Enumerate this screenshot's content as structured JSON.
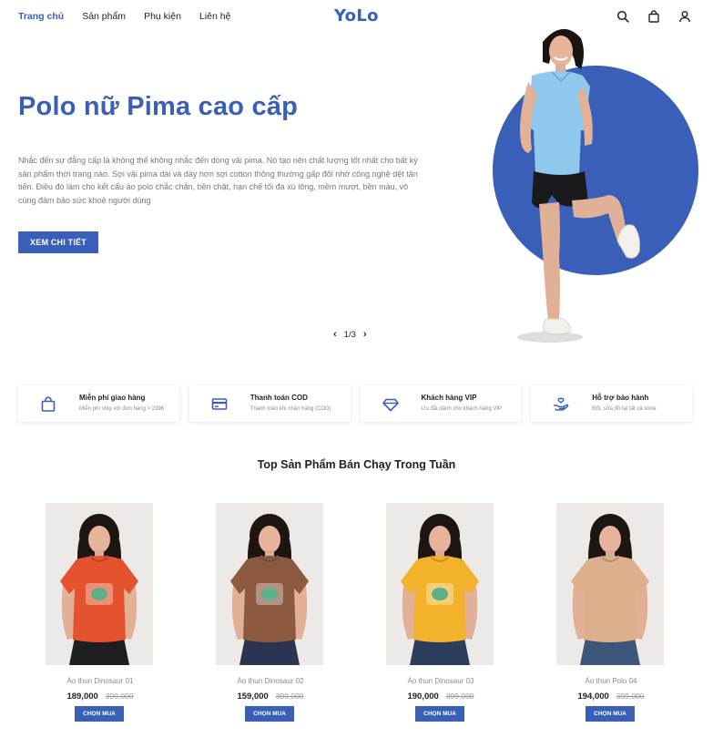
{
  "nav": {
    "items": [
      {
        "label": "Trang chủ",
        "active": true
      },
      {
        "label": "Sản phẩm",
        "active": false
      },
      {
        "label": "Phụ kiện",
        "active": false
      },
      {
        "label": "Liên hệ",
        "active": false
      }
    ],
    "logo": "YoLo",
    "icons": [
      "search-icon",
      "shopping-bag-icon",
      "user-icon"
    ]
  },
  "hero": {
    "title": "Polo nữ Pima cao cấp",
    "description": "Nhắc đến sự đẳng cấp là không thể không nhắc đến dòng vải pima. Nó tạo nên chất lượng tốt nhất cho bất kỳ sản phẩm thời trang nào. Sợi vải pima dài và dày hơn sợi cotton thông thường gấp đôi nhờ công nghệ dệt tân tiến. Điều đó làm cho kết cấu áo polo chắc chắn, bền chặt, hạn chế tối đa xù lông, mềm mượt, bền màu, vô cùng đảm bảo sức khoẻ người dùng",
    "button": "XEM CHI TIẾT",
    "slider": {
      "prev": "‹",
      "counter": "1/3",
      "next": "›"
    }
  },
  "features": [
    {
      "icon": "shopping-bag-icon",
      "title": "Miễn phí giao hàng",
      "subtitle": "Miễn phí ship với đơn hàng > 239K"
    },
    {
      "icon": "credit-card-icon",
      "title": "Thanh toán COD",
      "subtitle": "Thanh toán khi nhận hàng (COD)"
    },
    {
      "icon": "diamond-icon",
      "title": "Khách hàng VIP",
      "subtitle": "Ưu đãi dành cho khách hàng VIP"
    },
    {
      "icon": "hand-heart-icon",
      "title": "Hỗ trợ bảo hành",
      "subtitle": "Đổi, sửa đồ tại tất cả store"
    }
  ],
  "products_section": {
    "title": "Top Sản Phẩm Bán Chạy Trong Tuần",
    "items": [
      {
        "name": "Áo thun Dinosaur 01",
        "price": "189,000",
        "old_price": "399,000",
        "button": "CHỌN MUA",
        "shirt_color": "#e4532e",
        "bottom_color": "#1e1e22"
      },
      {
        "name": "Áo thun Dinosaur 02",
        "price": "159,000",
        "old_price": "399,000",
        "button": "CHỌN MUA",
        "shirt_color": "#8b5a40",
        "bottom_color": "#2a3550"
      },
      {
        "name": "Áo thun Dinosaur 03",
        "price": "190,000",
        "old_price": "399,000",
        "button": "CHỌN MUA",
        "shirt_color": "#f2b22c",
        "bottom_color": "#2b3c5c"
      },
      {
        "name": "Áo thun Polo 04",
        "price": "194,000",
        "old_price": "399,000",
        "button": "CHỌN MUA",
        "shirt_color": "#dcb08c",
        "bottom_color": "#3d5578"
      }
    ]
  },
  "colors": {
    "accent": "#3a5fb8",
    "text": "#222222",
    "muted": "#8a8a8a"
  }
}
